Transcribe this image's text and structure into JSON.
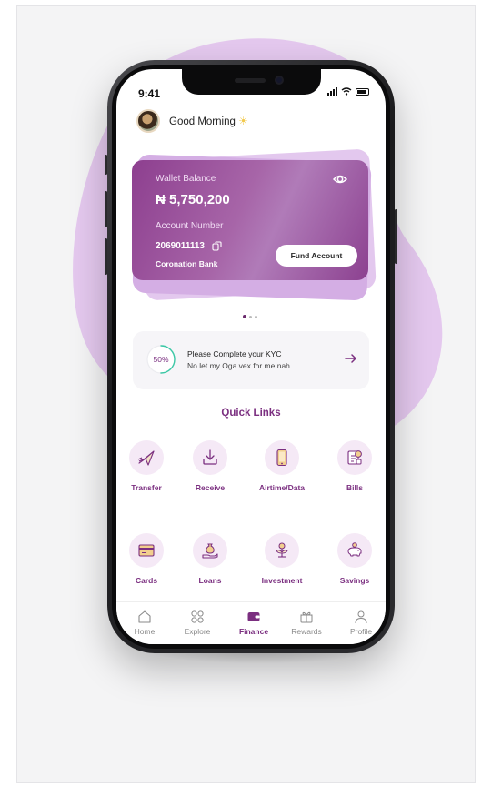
{
  "status_bar": {
    "time": "9:41"
  },
  "header": {
    "greeting": "Good Morning",
    "emoji": "☀"
  },
  "wallet_card": {
    "balance_label": "Wallet Balance",
    "balance": "₦ 5,750,200",
    "account_number_label": "Account Number",
    "account_number": "2069011113",
    "bank_name": "Coronation Bank",
    "fund_button_label": "Fund Account"
  },
  "carousel": {
    "pages": 3,
    "active": 1
  },
  "kyc": {
    "percent_label": "50%",
    "progress": 0.5,
    "title": "Please Complete your KYC",
    "subtitle": "No let my Oga vex for me nah"
  },
  "quick_links": {
    "title": "Quick Links",
    "items": [
      {
        "label": "Transfer",
        "icon": "paper-plane-icon"
      },
      {
        "label": "Receive",
        "icon": "download-tray-icon"
      },
      {
        "label": "Airtime/Data",
        "icon": "phone-icon"
      },
      {
        "label": "Bills",
        "icon": "bill-icon"
      },
      {
        "label": "Cards",
        "icon": "card-icon"
      },
      {
        "label": "Loans",
        "icon": "money-bag-hand-icon"
      },
      {
        "label": "Investment",
        "icon": "plant-coin-icon"
      },
      {
        "label": "Savings",
        "icon": "piggy-bank-icon"
      }
    ]
  },
  "tab_bar": {
    "items": [
      {
        "label": "Home",
        "icon": "home-icon"
      },
      {
        "label": "Explore",
        "icon": "grid-icon"
      },
      {
        "label": "Finance",
        "icon": "wallet-icon"
      },
      {
        "label": "Rewards",
        "icon": "gift-icon"
      },
      {
        "label": "Profile",
        "icon": "user-icon"
      }
    ],
    "active": "Finance"
  },
  "colors": {
    "brand": "#7b2f80",
    "card_gradient_start": "#8d3f8f",
    "card_gradient_end": "#b07bb8",
    "blob": "#e2c3ec",
    "kyc_ring": "#3cc8a6"
  }
}
